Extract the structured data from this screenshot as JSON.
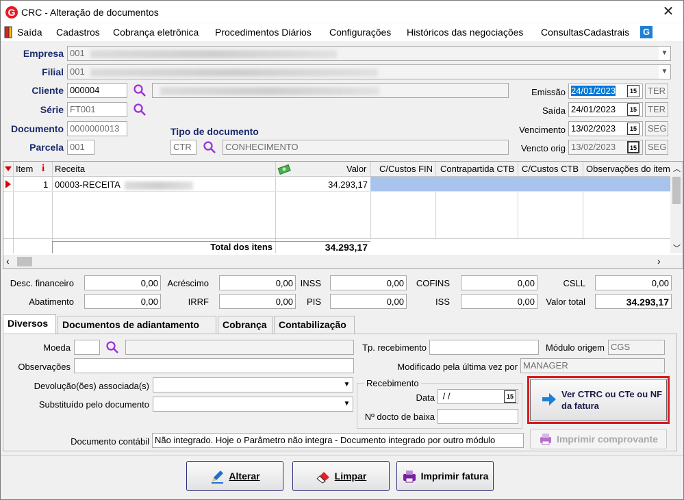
{
  "window": {
    "title": "CRC - Alteração de documentos",
    "app_icon": "G",
    "close_glyph": "✕"
  },
  "menu": [
    "Saída",
    "Cadastros",
    "Cobrança eletrônica",
    "Procedimentos Diários",
    "Configurações",
    "Históricos das negociações",
    "ConsultasCadastrais"
  ],
  "header": {
    "empresa_label": "Empresa",
    "empresa_value": "001",
    "filial_label": "Filial",
    "filial_value": "001",
    "cliente_label": "Cliente",
    "cliente_value": "000004",
    "serie_label": "Série",
    "serie_value": "FT001",
    "documento_label": "Documento",
    "documento_value": "0000000013",
    "parcela_label": "Parcela",
    "parcela_value": "001",
    "tipo_doc_label": "Tipo de documento",
    "tipo_doc_code": "CTR",
    "tipo_doc_desc": "CONHECIMENTO",
    "emissao_label": "Emissão",
    "emissao_value": "24/01/2023",
    "emissao_dow": "TER",
    "saida_label": "Saída",
    "saida_value": "24/01/2023",
    "saida_dow": "TER",
    "vencimento_label": "Vencimento",
    "vencimento_value": "13/02/2023",
    "vencimento_dow": "SEG",
    "vencto_orig_label": "Vencto orig",
    "vencto_orig_value": "13/02/2023",
    "vencto_orig_dow": "SEG"
  },
  "grid": {
    "columns": [
      "Item",
      "Receita",
      "Valor",
      "C/Custos FIN",
      "Contrapartida CTB",
      "C/Custos CTB",
      "Observações do item"
    ],
    "rows": [
      {
        "item": "1",
        "receita": "00003-RECEITA",
        "valor": "34.293,17"
      }
    ],
    "total_label": "Total dos itens",
    "total_value": "34.293,17"
  },
  "totals": {
    "desc_financeiro_label": "Desc. financeiro",
    "desc_financeiro": "0,00",
    "acrescimo_label": "Acréscimo",
    "acrescimo": "0,00",
    "inss_label": "INSS",
    "inss": "0,00",
    "cofins_label": "COFINS",
    "cofins": "0,00",
    "csll_label": "CSLL",
    "csll": "0,00",
    "abatimento_label": "Abatimento",
    "abatimento": "0,00",
    "irrf_label": "IRRF",
    "irrf": "0,00",
    "pis_label": "PIS",
    "pis": "0,00",
    "iss_label": "ISS",
    "iss": "0,00",
    "valor_total_label": "Valor total",
    "valor_total": "34.293,17"
  },
  "tabs": [
    "Diversos",
    "Documentos de adiantamento",
    "Cobrança",
    "Contabilização"
  ],
  "diversos": {
    "moeda_label": "Moeda",
    "moeda_value": "",
    "observacoes_label": "Observações",
    "observacoes_value": "",
    "devolucoes_label": "Devolução(ões) associada(s)",
    "substituido_label": "Substituído pelo documento",
    "tp_recebimento_label": "Tp. recebimento",
    "tp_recebimento_value": "",
    "modulo_origem_label": "Módulo origem",
    "modulo_origem_value": "CGS",
    "modificado_label": "Modificado pela última vez por",
    "modificado_value": "MANAGER",
    "recebimento_group": "Recebimento",
    "data_label": "Data",
    "data_value": " / /",
    "docto_baixa_label": "Nº docto de baixa",
    "docto_baixa_value": "",
    "doc_contabil_label": "Documento contábil",
    "doc_contabil_value": "Não integrado. Hoje o Parâmetro não integra - Documento integrado por outro módulo",
    "ver_ctrc_button": "Ver CTRC ou CTe ou NF da fatura",
    "imprimir_comprovante_button": "Imprimir comprovante"
  },
  "footer": {
    "alterar": "Alterar",
    "limpar": "Limpar",
    "imprimir_fatura": "Imprimir fatura"
  },
  "colors": {
    "accent": "#1a2a6c",
    "highlight_border": "#d9191f",
    "selected_row": "#a8c4ec",
    "date_selection": "#0078d7"
  }
}
